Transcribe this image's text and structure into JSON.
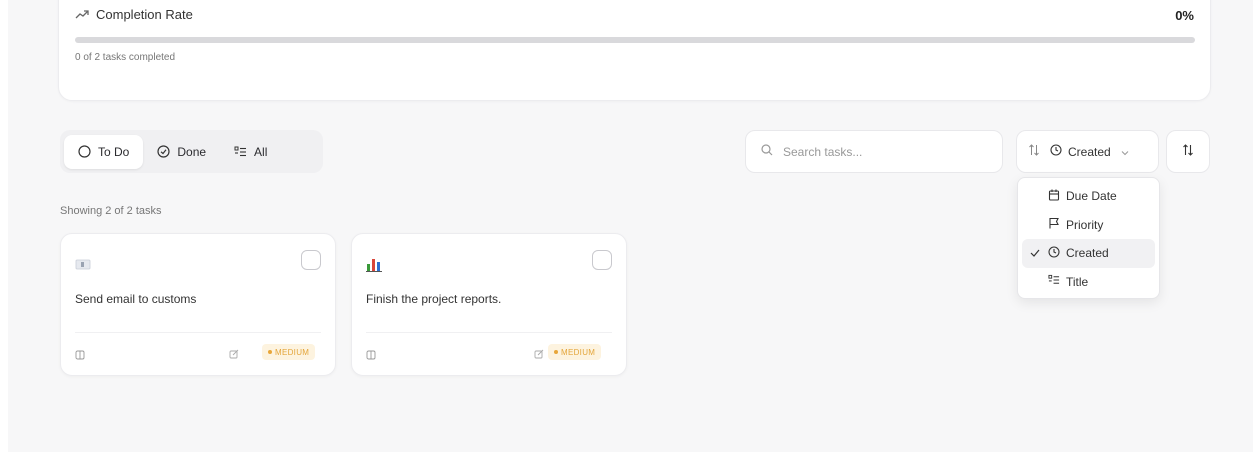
{
  "progress": {
    "label": "Completion Rate",
    "percent_text": "0%",
    "progress_fraction": 0,
    "completed_text": "0 of 2 tasks completed"
  },
  "tabs": [
    {
      "label": "To Do",
      "icon": "circle-icon",
      "active": true
    },
    {
      "label": "Done",
      "icon": "check-circle-icon",
      "active": false
    },
    {
      "label": "All",
      "icon": "list-icon",
      "active": false
    }
  ],
  "search": {
    "placeholder": "Search tasks..."
  },
  "sort": {
    "selected": "Created",
    "options": [
      {
        "label": "Due Date",
        "icon": "calendar-icon"
      },
      {
        "label": "Priority",
        "icon": "flag-icon"
      },
      {
        "label": "Created",
        "icon": "clock-icon",
        "selected": true
      },
      {
        "label": "Title",
        "icon": "list-icon"
      }
    ]
  },
  "showing": "Showing 2 of 2 tasks",
  "tasks": [
    {
      "icon": "card-index-icon",
      "title": "Send email to customs",
      "priority": "MEDIUM",
      "completed": false
    },
    {
      "icon": "bar-chart-icon",
      "title": "Finish the project reports.",
      "priority": "MEDIUM",
      "completed": false
    }
  ],
  "colors": {
    "medium_badge_bg": "#fdf3df",
    "medium_badge_text": "#e4a53a"
  }
}
